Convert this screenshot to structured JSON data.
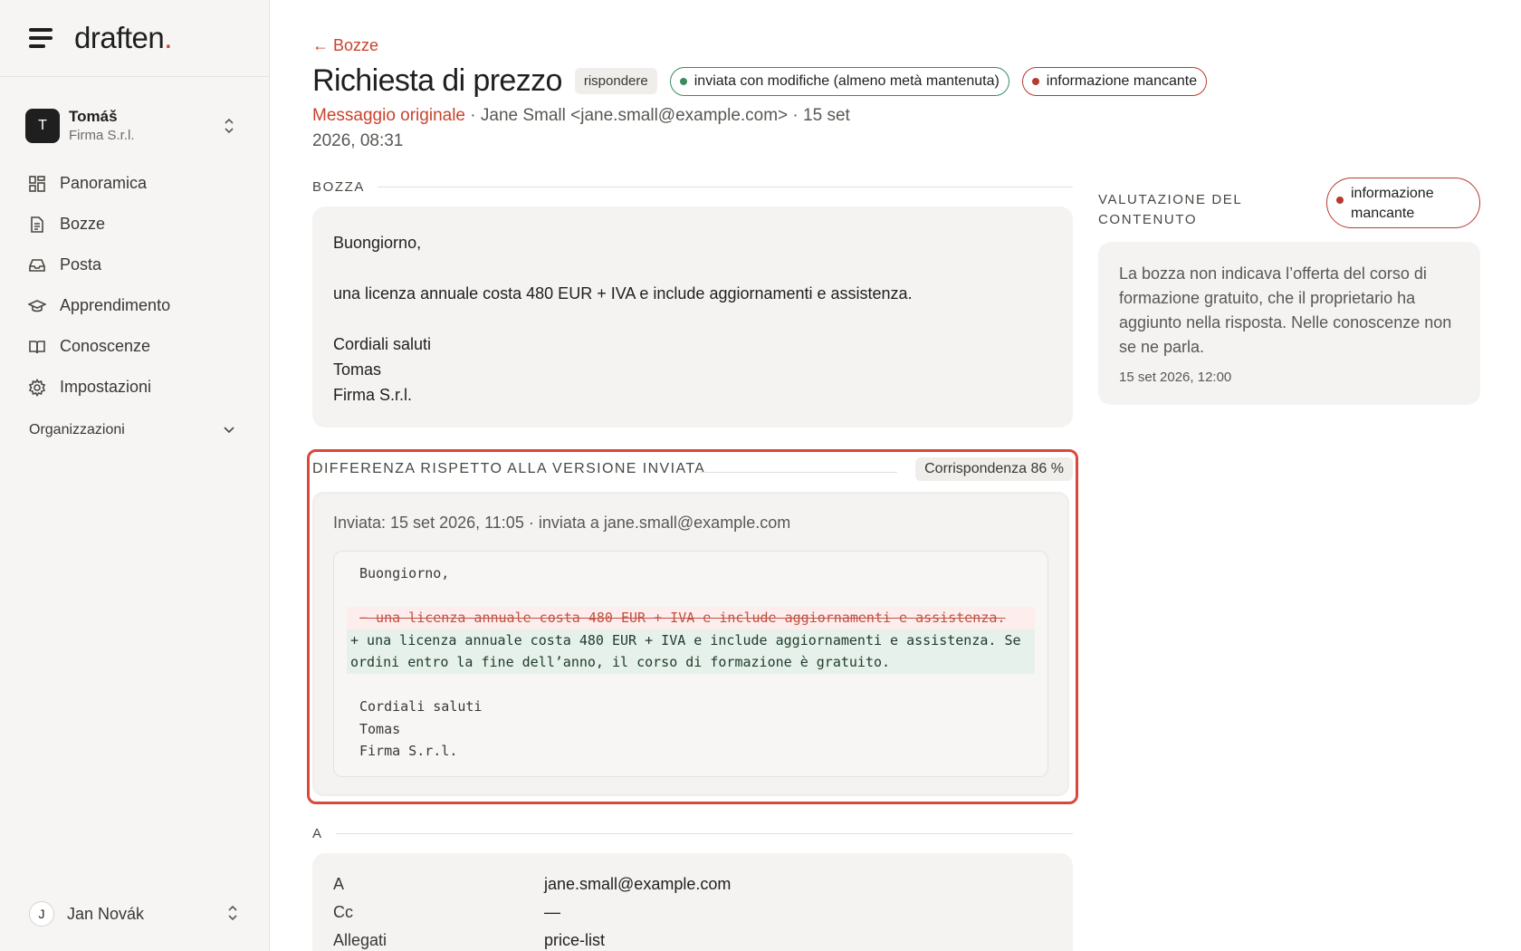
{
  "app": {
    "logo": "draften",
    "logo_dot": "."
  },
  "account": {
    "initial": "T",
    "name": "Tomáš",
    "org": "Firma S.r.l."
  },
  "nav": {
    "items": [
      {
        "label": "Panoramica",
        "icon": "grid-icon"
      },
      {
        "label": "Bozze",
        "icon": "document-icon"
      },
      {
        "label": "Posta",
        "icon": "inbox-icon"
      },
      {
        "label": "Apprendimento",
        "icon": "graduation-cap-icon"
      },
      {
        "label": "Conoscenze",
        "icon": "book-icon"
      },
      {
        "label": "Impostazioni",
        "icon": "gear-icon"
      }
    ],
    "organizations_label": "Organizzazioni"
  },
  "user": {
    "initial": "J",
    "name": "Jan Novák"
  },
  "header": {
    "back_label": "← Bozze",
    "title": "Richiesta di prezzo",
    "type_tag": "rispondere",
    "status_pill": "inviata con modifiche (almeno metà mantenuta)",
    "info_pill": "informazione mancante",
    "original_link": "Messaggio originale",
    "original_meta": " · Jane Small <jane.small@example.com> · 15 set 2026, 08:31"
  },
  "draft": {
    "section_label": "BOZZA",
    "greeting": "Buongiorno,",
    "body": "una licenza annuale costa 480 EUR + IVA e include aggiornamenti e assistenza.",
    "closing": "Cordiali saluti",
    "signature_name": "Tomas",
    "signature_company": "Firma S.r.l."
  },
  "diff": {
    "section_label": "DIFFERENZA RISPETTO ALLA VERSIONE INVIATA",
    "match_label": "Corrispondenza 86 %",
    "sent_line": "Inviata: 15 set 2026, 11:05 · inviata a jane.small@example.com",
    "lines": {
      "greeting": "Buongiorno,",
      "removed": "− una licenza annuale costa 480 EUR + IVA e include aggiornamenti e assistenza.",
      "added": "+ una licenza annuale costa 480 EUR + IVA e include aggiornamenti e assistenza. Se ordini entro la fine dell’anno, il corso di formazione è gratuito.",
      "closing": "Cordiali saluti",
      "name": "Tomas",
      "company": "Firma S.r.l."
    }
  },
  "recipients": {
    "section_label": "A",
    "rows": [
      {
        "key": "A",
        "value": "jane.small@example.com"
      },
      {
        "key": "Cc",
        "value": "—"
      },
      {
        "key": "Allegati",
        "value": "price-list"
      }
    ]
  },
  "evaluation": {
    "section_label": "VALUTAZIONE DEL CONTENUTO",
    "pill": "informazione mancante",
    "text": "La bozza non indicava l’offerta del corso di formazione gratuito, che il proprietario ha aggiunto nella risposta. Nelle conoscenze non se ne parla.",
    "time": "15 set 2026, 12:00"
  },
  "colors": {
    "accent": "#c9432c",
    "success": "#3c8a5e",
    "danger": "#b73a2c",
    "highlight_border": "#d9493a"
  }
}
